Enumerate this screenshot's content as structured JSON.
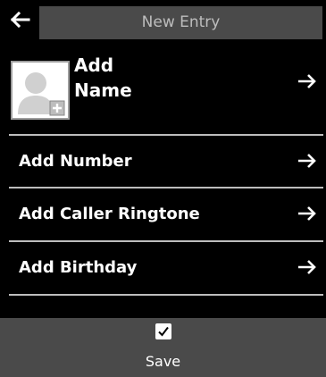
{
  "header": {
    "title": "New Entry",
    "back_icon": "arrow-left-icon"
  },
  "contact": {
    "name_line1": "Add",
    "name_line2": "Name",
    "avatar_icon": "contact-avatar-add-icon",
    "arrow_icon": "arrow-right-icon"
  },
  "rows": [
    {
      "label": "Add Number",
      "arrow_icon": "arrow-right-icon"
    },
    {
      "label": "Add Caller Ringtone",
      "arrow_icon": "arrow-right-icon"
    },
    {
      "label": "Add Birthday",
      "arrow_icon": "arrow-right-icon"
    }
  ],
  "footer": {
    "save_label": "Save",
    "check_icon": "checkmark-icon"
  },
  "colors": {
    "background": "#000000",
    "header_bar": "#4a4a4a",
    "title_text": "#bdbdbd",
    "divider": "#bdbdbd",
    "footer_bar": "#4a4a4a",
    "text": "#ffffff"
  }
}
